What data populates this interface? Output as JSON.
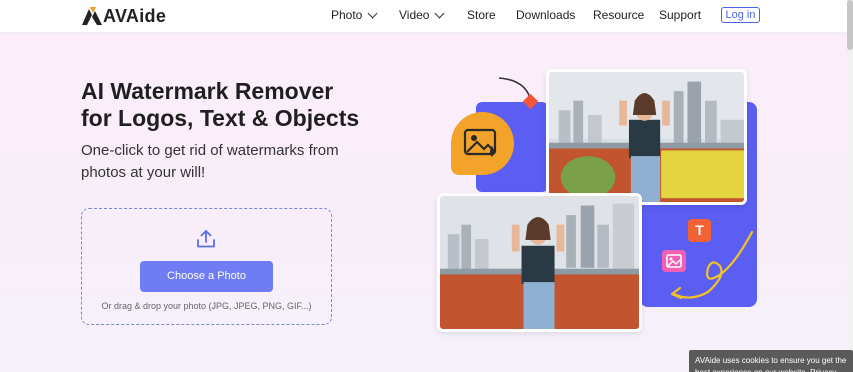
{
  "header": {
    "logo_text": "AVAide",
    "nav": [
      {
        "label": "Photo",
        "has_dropdown": true
      },
      {
        "label": "Video",
        "has_dropdown": true
      },
      {
        "label": "Store",
        "has_dropdown": false
      },
      {
        "label": "Downloads",
        "has_dropdown": false
      },
      {
        "label": "Resource",
        "has_dropdown": false
      },
      {
        "label": "Support",
        "has_dropdown": false
      }
    ],
    "login_label": "Log in"
  },
  "hero": {
    "title_line1": "AI Watermark Remover",
    "title_line2": "for Logos, Text & Objects",
    "subtitle_line1": "One-click to get rid of watermarks from",
    "subtitle_line2": "photos at your will!",
    "choose_button": "Choose a Photo",
    "drag_hint": "Or drag & drop your photo (JPG, JPEG, PNG, GIF...)"
  },
  "illustration": {
    "badge_letter": "T"
  },
  "cookie": {
    "text": "AVAide uses cookies to ensure you get the best experience on our website. Privacy Policy"
  },
  "colors": {
    "accent": "#6f7cf4",
    "purple_block": "#5b5ef2",
    "orange": "#f3a22a",
    "hero_bg": "#fbeefa"
  }
}
